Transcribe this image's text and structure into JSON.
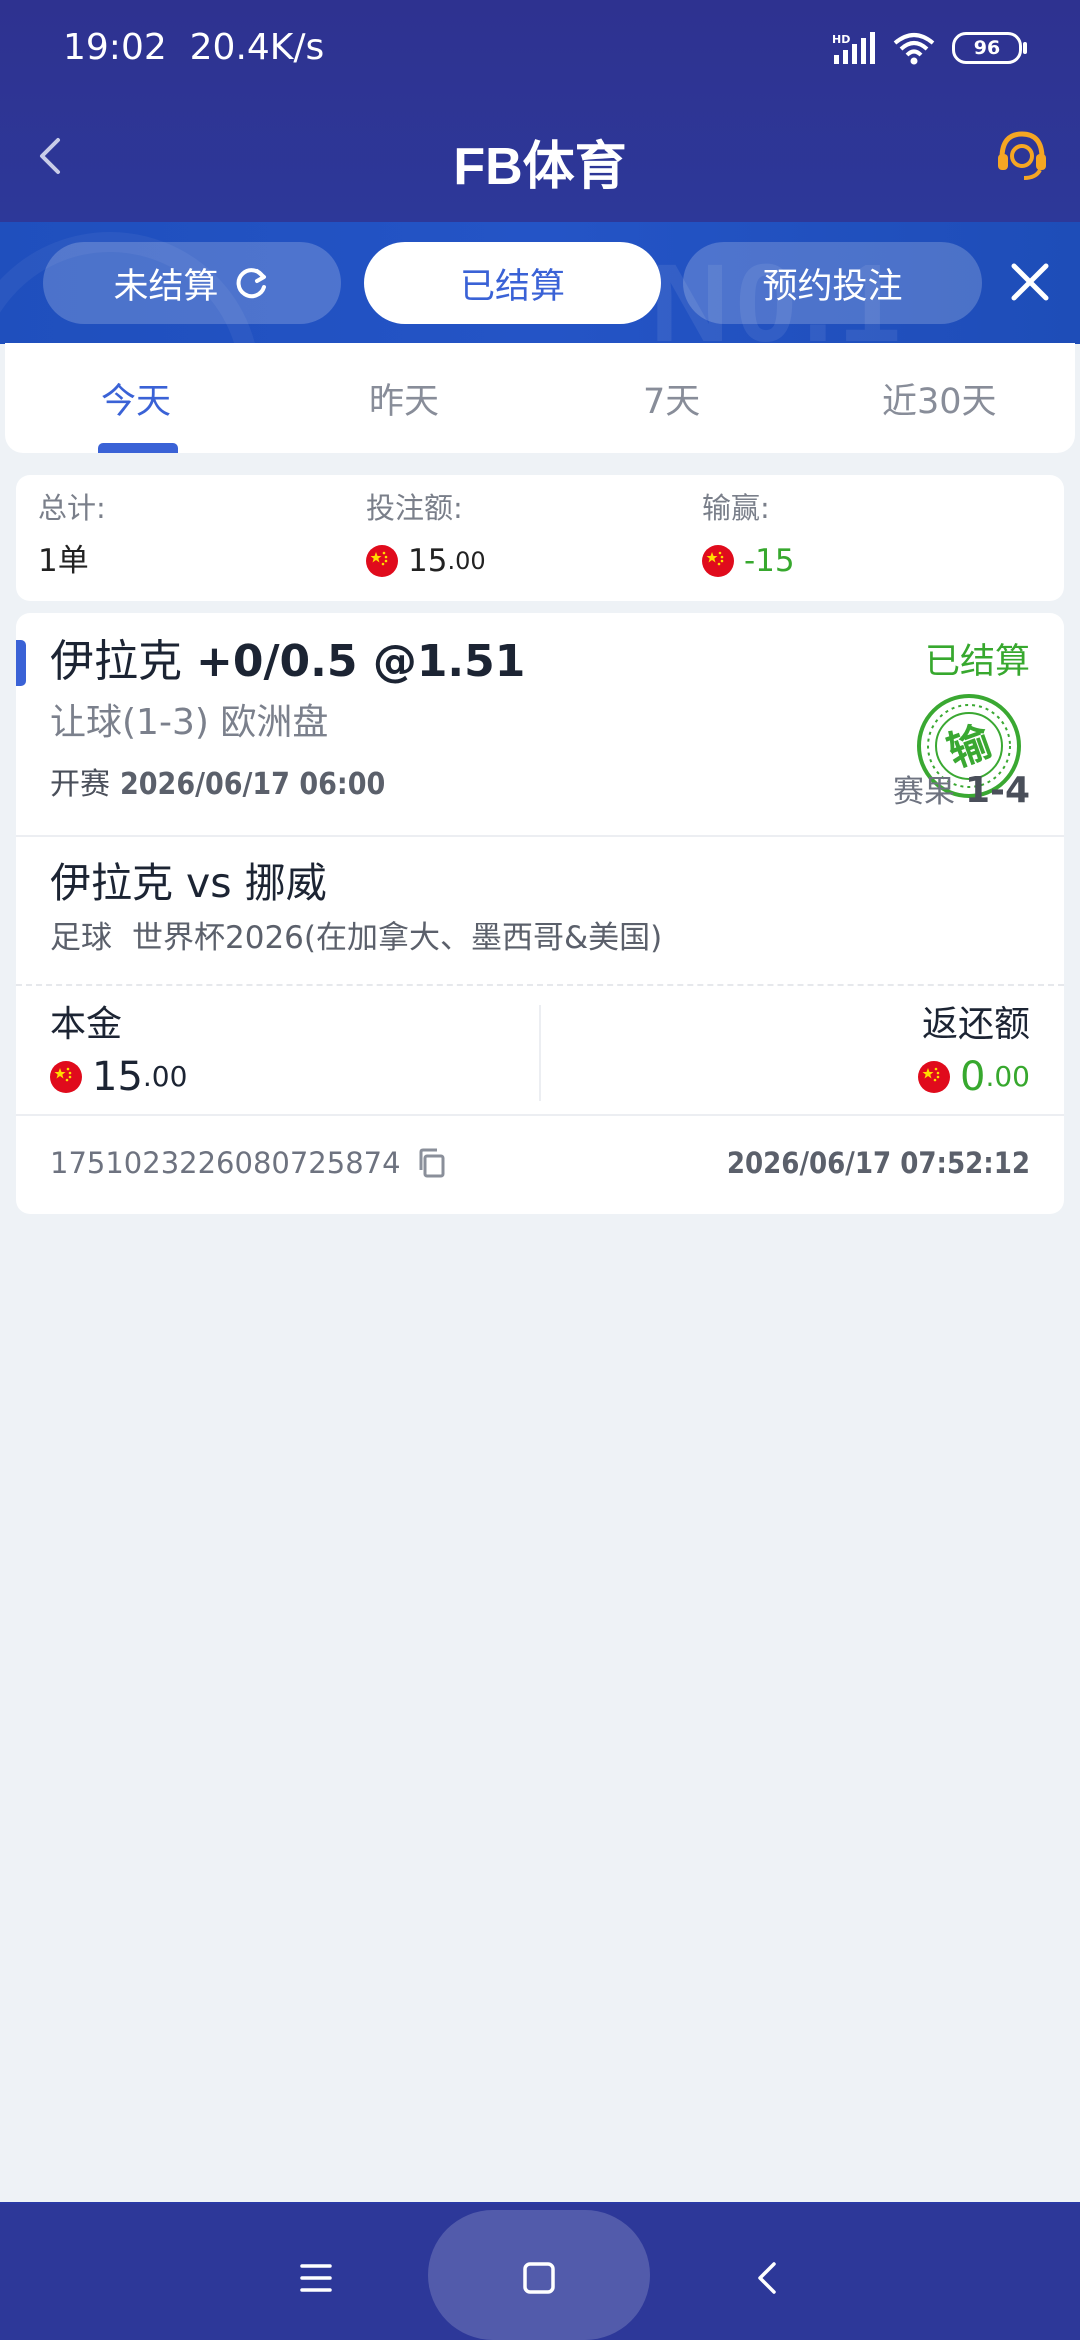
{
  "status_bar": {
    "time": "19:02",
    "speed": "20.4K/s",
    "network": "HD",
    "battery": "96"
  },
  "header": {
    "title": "FB体育",
    "back_icon": "chevron-left-icon",
    "support_icon": "headset-icon"
  },
  "segments": {
    "pending_label": "未结算",
    "settled_label": "已结算",
    "booking_label": "预约投注",
    "active": "已结算"
  },
  "date_tabs": {
    "items": [
      "今天",
      "昨天",
      "7天",
      "近30天"
    ],
    "active_index": 0
  },
  "summary": {
    "total_label": "总计:",
    "total_value": "1单",
    "stake_label": "投注额:",
    "stake_int": "15",
    "stake_dec": ".00",
    "winloss_label": "输赢:",
    "winloss_value": "-15"
  },
  "bet": {
    "team": "伊拉克",
    "selection": "+0/0.5 @1.51",
    "market": "让球(1-3) 欧洲盘",
    "start_label": "开赛",
    "start_time": "2026/06/17 06:00",
    "status": "已结算",
    "stamp_text": "输",
    "result_label": "赛果",
    "result_score": "1-4",
    "match": "伊拉克 vs 挪威",
    "sport": "足球",
    "league": "世界杯2026(在加拿大、墨西哥&美国)",
    "stake_label": "本金",
    "stake_int": "15",
    "stake_dec": ".00",
    "return_label": "返还额",
    "return_int": "0",
    "return_dec": ".00",
    "order_id": "1751023226080725874",
    "settle_time": "2026/06/17 07:52:12"
  },
  "colors": {
    "header_bg": "#2e3290",
    "accent_blue": "#3a62d6",
    "win_green": "#37a82e",
    "loss_red": "#e00b1c"
  }
}
